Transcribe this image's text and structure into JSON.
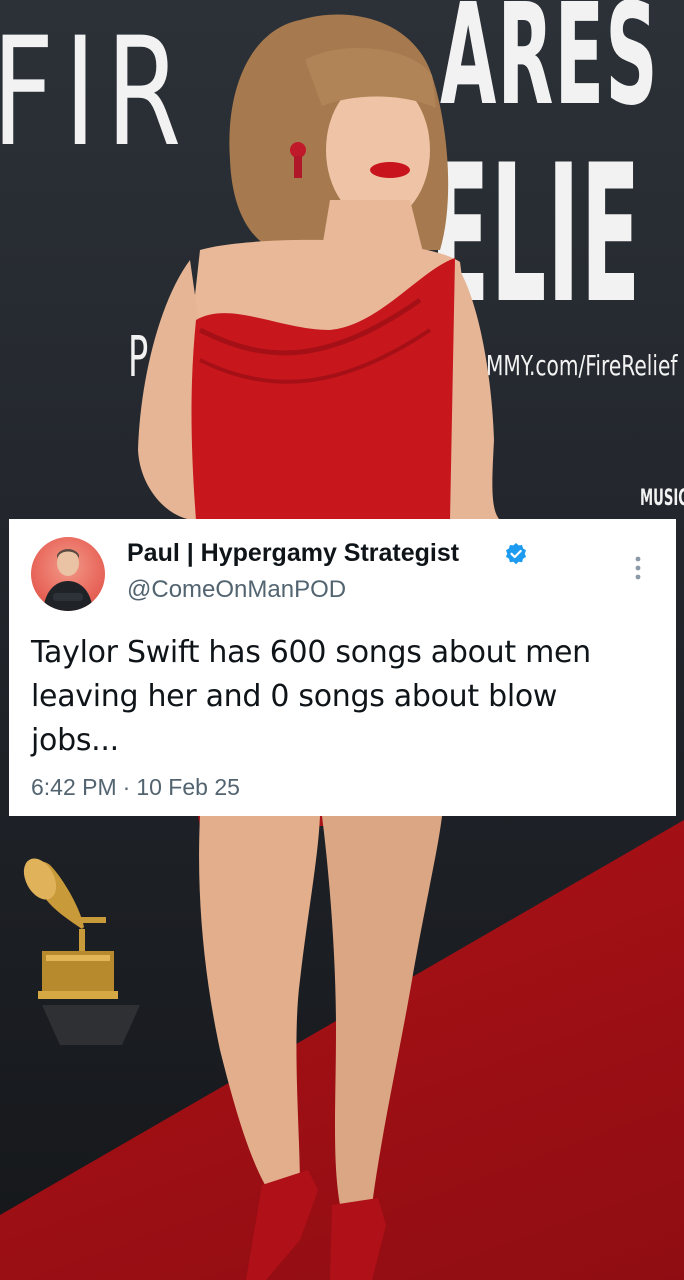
{
  "backdrop": {
    "fire_text": "FIR",
    "cares_text": "ARES",
    "relief_text": "ELIE",
    "p_text": "P",
    "url_text": "MMY.com/FireRelief",
    "music_text": "MUSIC"
  },
  "tweet": {
    "author_name": "Paul | Hypergamy Strategist",
    "author_handle": "@ComeOnManPOD",
    "verified": true,
    "text": "Taylor Swift has 600 songs about men leaving her and 0 songs about blow jobs...",
    "time": "6:42 PM",
    "date": "10 Feb 25"
  },
  "colors": {
    "verified_badge": "#1d9bf0",
    "dress": "#c8161d",
    "carpet": "#c4161b",
    "handle": "#536471"
  },
  "icons": {
    "verified": "verified-badge-icon",
    "more": "more-vertical-icon",
    "trophy": "gramophone-trophy-icon"
  }
}
